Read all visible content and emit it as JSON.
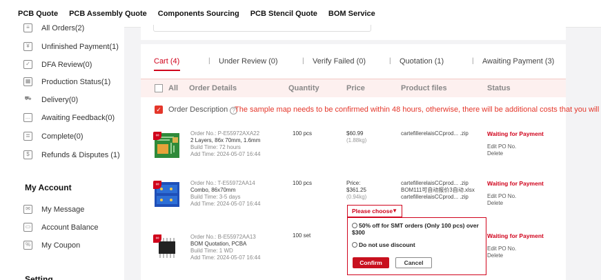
{
  "topnav": [
    "PCB Quote",
    "PCB Assembly Quote",
    "Components Sourcing",
    "PCB Stencil Quote",
    "BOM Service"
  ],
  "sidebar": {
    "orders": [
      {
        "label": "All Orders(2)",
        "icon": "list-icon"
      },
      {
        "label": "Unfinished Payment(1)",
        "icon": "bill-icon"
      },
      {
        "label": "DFA Review(0)",
        "icon": "review-icon"
      },
      {
        "label": "Production Status(1)",
        "icon": "factory-icon"
      },
      {
        "label": "Delivery(0)",
        "icon": "truck-icon"
      },
      {
        "label": "Awaiting Feedback(0)",
        "icon": "chat-icon"
      },
      {
        "label": "Complete(0)",
        "icon": "check-doc-icon"
      },
      {
        "label": "Refunds & Disputes (1)",
        "icon": "dollar-icon"
      }
    ],
    "account_heading": "My Account",
    "account": [
      {
        "label": "My Message",
        "icon": "mail-icon"
      },
      {
        "label": "Account Balance",
        "icon": "wallet-icon"
      },
      {
        "label": "My Coupon",
        "icon": "coupon-icon"
      }
    ],
    "setting_heading": "Setting"
  },
  "tabs": [
    "Cart (4)",
    "Under Review (0)",
    "Verify Failed (0)",
    "Quotation (1)",
    "Awaiting Payment (3)"
  ],
  "table_headers": {
    "all": "All",
    "details": "Order Details",
    "quantity": "Quantity",
    "price": "Price",
    "files": "Product files",
    "status": "Status"
  },
  "description": {
    "label": "Order Description",
    "warning": "The sample map needs to be confirmed within 48 hours, otherwise, there will be additional costs that you will bear."
  },
  "orders": [
    {
      "order_no": "Order No.: P-E55972AXA22",
      "spec": "2 Layers, 86x 70mm, 1.6mm",
      "build": "Build Time: 72 hours",
      "added": "Add Time: 2024-05-07 16:44",
      "qty": "100 pcs",
      "price_label": "",
      "price": "$60.99",
      "weight": "(1.88kg)",
      "files": [
        "cartefillerelaisCCprod... .zip"
      ],
      "status": "Waiting for Payment",
      "actions": [
        "Edit PO No.",
        "Delete"
      ]
    },
    {
      "order_no": "Order No.: T-E55972AA14",
      "spec": "Combo, 86x70mm",
      "build": "Build Time: 3-5 days",
      "added": "Add Time: 2024-05-07 16:44",
      "qty": "100 pcs",
      "price_label": "Price:",
      "price": "$361.25",
      "weight": "(0.94kg)",
      "files": [
        "cartefillerelaisCCprod... .zip",
        "BOM111可自动报价3自动.xlsx",
        "cartefillerelaisCCprod... .zip"
      ],
      "status": "Waiting for Payment",
      "actions": [
        "Edit PO No.",
        "Delete"
      ]
    },
    {
      "order_no": "Order No.: B-E55972AA13",
      "spec": "BOM Quotation, PCBA",
      "build": "Build Time: 1 WD",
      "added": "Add Time: 2024-05-07 16:44",
      "qty": "100 set",
      "price_label": "",
      "price": "",
      "weight": "",
      "files": [],
      "status": "Waiting for Payment",
      "actions": [
        "Edit PO No.",
        "Delete"
      ]
    }
  ],
  "discount_dropdown": {
    "selected": "Please choose",
    "options": [
      "50% off for SMT orders  (Only 100 pcs)  over $300",
      "Do not use discount"
    ],
    "confirm": "Confirm",
    "cancel": "Cancel"
  },
  "colors": {
    "accent": "#d0021b",
    "header_bg": "#fdf0ef"
  }
}
